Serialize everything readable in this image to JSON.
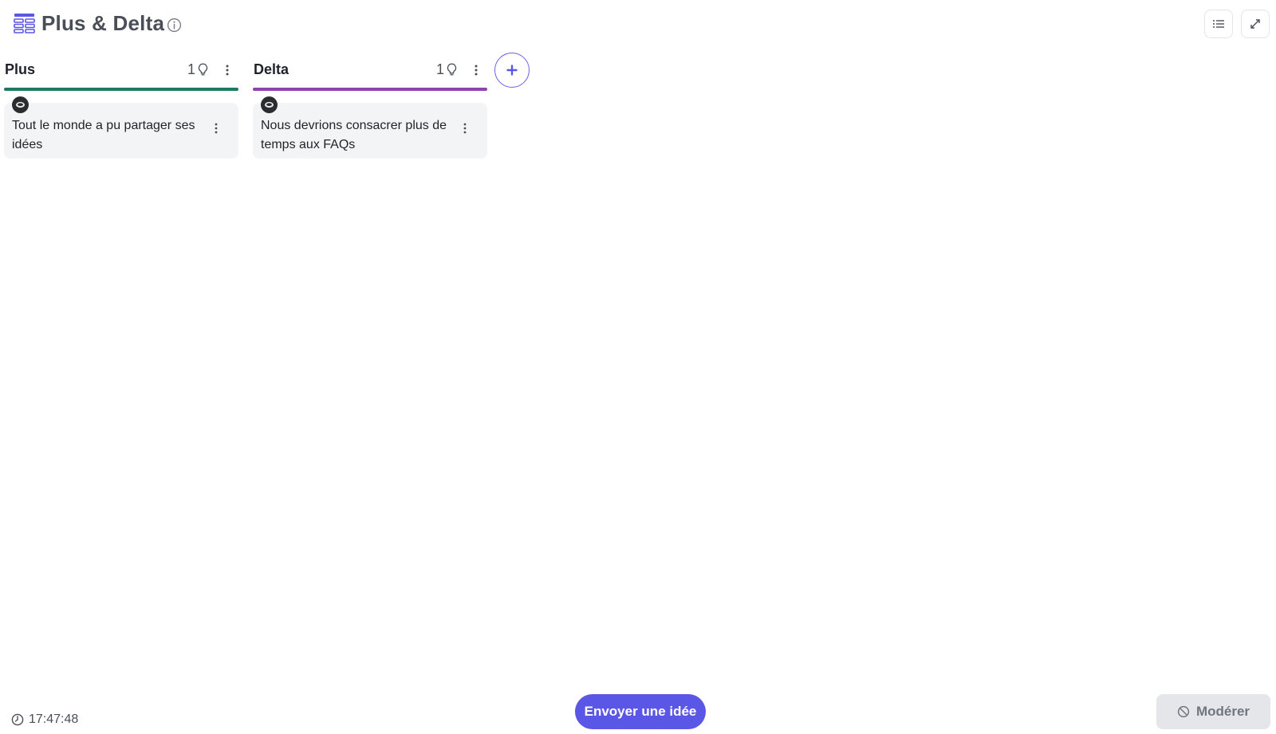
{
  "header": {
    "title": "Plus & Delta",
    "icons": {
      "board": "board-grid-icon",
      "info": "info-icon",
      "list": "list-icon",
      "expand": "expand-icon"
    },
    "accent": "#5b57e6"
  },
  "columns": [
    {
      "title": "Plus",
      "count": "1",
      "bar_color": "#1e7a5f",
      "cards": [
        {
          "text": "Tout le monde a pu partager ses idées"
        }
      ]
    },
    {
      "title": "Delta",
      "count": "1",
      "bar_color": "#8e44ad",
      "cards": [
        {
          "text": "Nous devrions consacrer plus de temps aux FAQs"
        }
      ]
    }
  ],
  "footer": {
    "time": "17:47:48",
    "send_label": "Envoyer une idée",
    "moderate_label": "Modérer"
  }
}
